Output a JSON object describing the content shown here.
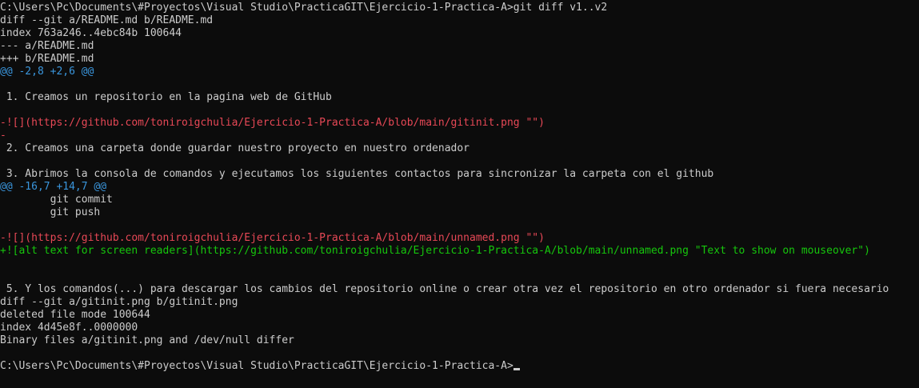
{
  "window": {
    "background": "#0c0c0c"
  },
  "colors": {
    "default": "#cccccc",
    "hunk": "#3a96dd",
    "removed": "#e74856",
    "added": "#16c60c"
  },
  "terminal": {
    "lines": [
      {
        "text": "C:\\Users\\Pc\\Documents\\#Proyectos\\Visual Studio\\PracticaGIT\\Ejercicio-1-Practica-A>git diff v1..v2",
        "kind": "default"
      },
      {
        "text": "diff --git a/README.md b/README.md",
        "kind": "default"
      },
      {
        "text": "index 763a246..4ebc84b 100644",
        "kind": "default"
      },
      {
        "text": "--- a/README.md",
        "kind": "default"
      },
      {
        "text": "+++ b/README.md",
        "kind": "default"
      },
      {
        "text": "@@ -2,8 +2,6 @@",
        "kind": "hunk"
      },
      {
        "text": "",
        "kind": "default"
      },
      {
        "text": " 1. Creamos un repositorio en la pagina web de GitHub",
        "kind": "default"
      },
      {
        "text": "",
        "kind": "default"
      },
      {
        "text": "-![](https://github.com/toniroigchulia/Ejercicio-1-Practica-A/blob/main/gitinit.png \"\")",
        "kind": "removed"
      },
      {
        "text": "-",
        "kind": "removed"
      },
      {
        "text": " 2. Creamos una carpeta donde guardar nuestro proyecto en nuestro ordenador",
        "kind": "default"
      },
      {
        "text": "",
        "kind": "default"
      },
      {
        "text": " 3. Abrimos la consola de comandos y ejecutamos los siguientes contactos para sincronizar la carpeta con el github",
        "kind": "default"
      },
      {
        "text": "@@ -16,7 +14,7 @@",
        "kind": "hunk"
      },
      {
        "text": "        git commit",
        "kind": "default"
      },
      {
        "text": "        git push",
        "kind": "default"
      },
      {
        "text": "",
        "kind": "default"
      },
      {
        "text": "-![](https://github.com/toniroigchulia/Ejercicio-1-Practica-A/blob/main/unnamed.png \"\")",
        "kind": "removed"
      },
      {
        "text": "+![alt text for screen readers](https://github.com/toniroigchulia/Ejercicio-1-Practica-A/blob/main/unnamed.png \"Text to show on mouseover\")",
        "kind": "added"
      },
      {
        "text": "",
        "kind": "default"
      },
      {
        "text": "",
        "kind": "default"
      },
      {
        "text": " 5. Y los comandos(...) para descargar los cambios del repositorio online o crear otra vez el repositorio en otro ordenador si fuera necesario",
        "kind": "default"
      },
      {
        "text": "diff --git a/gitinit.png b/gitinit.png",
        "kind": "default"
      },
      {
        "text": "deleted file mode 100644",
        "kind": "default"
      },
      {
        "text": "index 4d45e8f..0000000",
        "kind": "default"
      },
      {
        "text": "Binary files a/gitinit.png and /dev/null differ",
        "kind": "default"
      },
      {
        "text": "",
        "kind": "default"
      }
    ],
    "prompt": "C:\\Users\\Pc\\Documents\\#Proyectos\\Visual Studio\\PracticaGIT\\Ejercicio-1-Practica-A>"
  }
}
